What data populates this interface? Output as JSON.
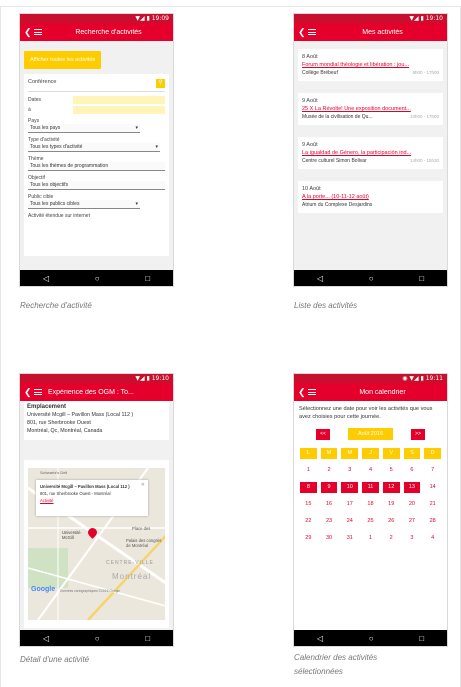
{
  "screens": {
    "search": {
      "status": "▼◢ ▮ 19:09",
      "title": "Recherche d'activités",
      "show_all_button": "Afficher toutes les activités",
      "search_value": "Conférence",
      "labels": {
        "dates": "Dates",
        "to": "à",
        "country": "Pays",
        "type": "Type d'activité",
        "theme": "Thème",
        "objective": "Objectif",
        "audience": "Public cible",
        "extended": "Activité étendue sur internet"
      },
      "values": {
        "country": "Tous les pays",
        "type": "Tous les types d'activité",
        "theme": "Tous les thèmes de programmation",
        "objective": "Tous les objectifs",
        "audience": "Tous les publics cibles"
      },
      "caption": "Recherche d'activité"
    },
    "list": {
      "status": "▼◢ ▮ 19:10",
      "title": "Mes activités",
      "items": [
        {
          "date": "8 Août",
          "title": "Forum mondial théologie et libération : jou...",
          "place": "Collège Brébeuf",
          "time": "9h00 - 17h00"
        },
        {
          "date": "9 Août",
          "title": "25 X La Révolte! Une exposition document...",
          "place": "Musée de la civilisation de Qu...",
          "time": "10h00 - 17h00"
        },
        {
          "date": "9 Août",
          "title": "La igualdad de Género, la participación ind...",
          "place": "Centre culturel Simon Bolivar",
          "time": "14h00 - 15h30"
        },
        {
          "date": "10 Août",
          "title": "A la porte... (10-11-12 août)",
          "place": "Atrium du Complexe Desjardins",
          "time": ""
        }
      ],
      "caption": "Liste des activités"
    },
    "detail": {
      "status": "▼◢ ▮ 19:10",
      "title": "Expérience des OGM : To...",
      "heading": "Emplacement",
      "address_1": "Université Mcgill – Pavillon Mass (Local 112 )",
      "address_2": "801, rue Sherbrooke Ouest",
      "address_3": "Montréal, Qc, Montréal, Canada",
      "popup_title": "Université Mcgill – Pavillon Mass (Local 112 )",
      "popup_address": "801, rue Sherbrooke Ouest - Montréal",
      "popup_link": "Activité",
      "map_labels": {
        "schwartz": "Schwartz's Deli",
        "mcgill": "Université McGill",
        "place_des_arts": "Place des",
        "palais": "Palais des congrès de Montréal",
        "centre_ville": "CENTRE-VILLE",
        "montreal": "Montréal",
        "google": "Google",
        "attribution": "Données cartographiques ©2016 Google"
      },
      "caption": "Détail d'une activité"
    },
    "calendar": {
      "status": "◉ ▼◢ ▮ 19:11",
      "title": "Mon calendrier",
      "instructions": "Sélectionnez une date pour voir les activités que vous avez choisies pour cette journée.",
      "prev": "<<",
      "next": ">>",
      "month": "Août 2016",
      "weekdays": [
        "L",
        "M",
        "M",
        "J",
        "V",
        "S",
        "D"
      ],
      "rows": [
        [
          "1",
          "2",
          "3",
          "4",
          "5",
          "6",
          "7"
        ],
        [
          "8",
          "9",
          "10",
          "11",
          "12",
          "13",
          "14"
        ],
        [
          "15",
          "16",
          "17",
          "18",
          "19",
          "20",
          "21"
        ],
        [
          "22",
          "23",
          "24",
          "25",
          "26",
          "27",
          "28"
        ],
        [
          "29",
          "30",
          "31",
          "1",
          "2",
          "3",
          "4"
        ]
      ],
      "caption_line1": "Calendrier des activités",
      "caption_line2": "sélectionnées"
    }
  },
  "nav": {
    "back": "◁",
    "home": "○",
    "recent": "□"
  },
  "colors": {
    "brand_red": "#e4002b",
    "accent_yellow": "#ffcc00"
  }
}
